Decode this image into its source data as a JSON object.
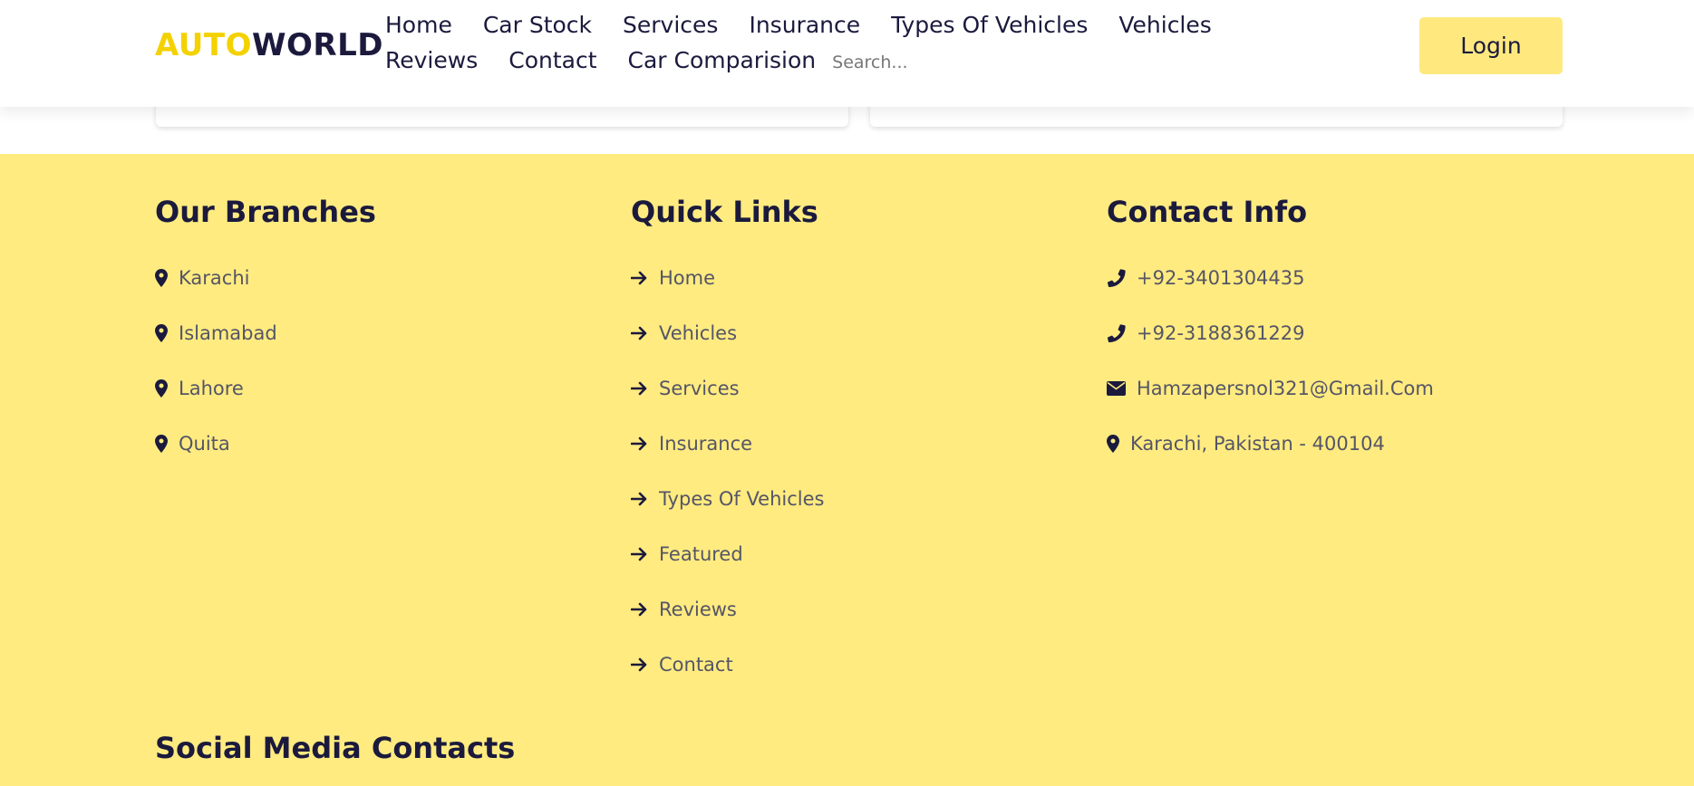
{
  "header": {
    "logo_part1": "AUTO",
    "logo_part2": "WORLD",
    "nav": [
      "Home",
      "Car Stock",
      "Services",
      "Insurance",
      "Types Of Vehicles",
      "Vehicles",
      "Reviews",
      "Contact",
      "Car Comparision"
    ],
    "search_placeholder": "Search...",
    "login_label": "Login"
  },
  "footer": {
    "branches": {
      "title": "Our Branches",
      "items": [
        "Karachi",
        "Islamabad",
        "Lahore",
        "Quita"
      ]
    },
    "links": {
      "title": "Quick Links",
      "items": [
        "Home",
        "Vehicles",
        "Services",
        "Insurance",
        "Types Of Vehicles",
        "Featured",
        "Reviews",
        "Contact"
      ]
    },
    "contact": {
      "title": "Contact Info",
      "phone1": "+92-3401304435",
      "phone2": "+92-3188361229",
      "email": "Hamzapersnol321@Gmail.Com",
      "address": "Karachi, Pakistan - 400104"
    },
    "social_title": "Social Media Contacts"
  },
  "colors": {
    "accent": "#f4d100",
    "footer_bg": "#ffeb80",
    "button_bg": "#ffe97f",
    "text_dark": "#1b1a3d",
    "text_muted": "#555566"
  },
  "icons": {
    "branch": "map-marker-icon",
    "link": "arrow-right-icon",
    "phone": "phone-icon",
    "email": "envelope-icon",
    "address": "map-marker-icon"
  }
}
